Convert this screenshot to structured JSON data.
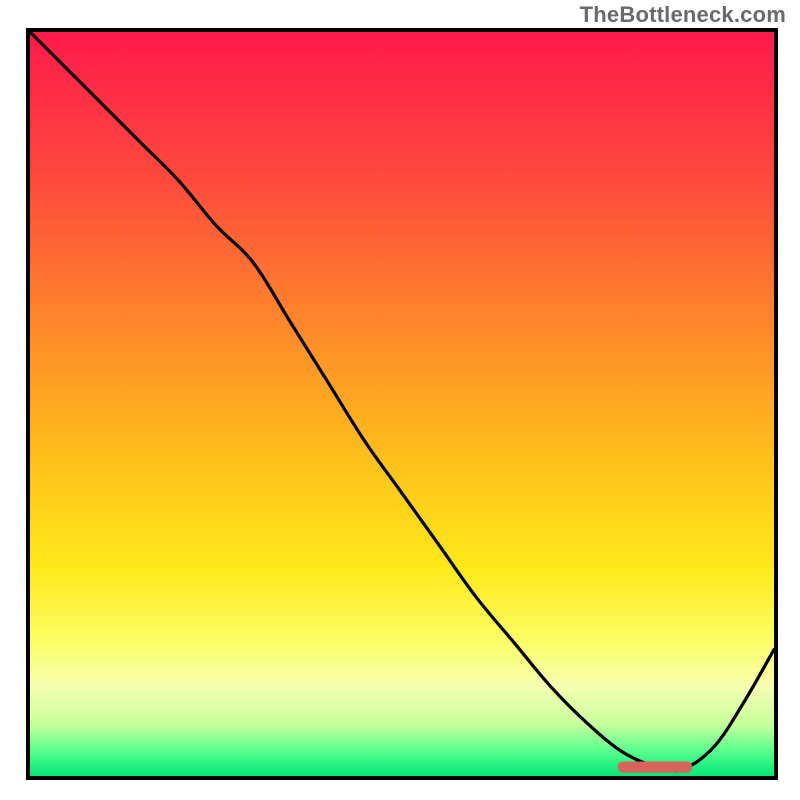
{
  "attribution": "TheBottleneck.com",
  "colors": {
    "border": "#000000",
    "curve": "#000000",
    "marker": "#d9635a",
    "gradient_stops": [
      {
        "offset": 0.0,
        "color": "#ff1a4b"
      },
      {
        "offset": 0.2,
        "color": "#ff4a3d"
      },
      {
        "offset": 0.4,
        "color": "#ff8a2a"
      },
      {
        "offset": 0.58,
        "color": "#ffc21a"
      },
      {
        "offset": 0.72,
        "color": "#ffe91a"
      },
      {
        "offset": 0.82,
        "color": "#fbff66"
      },
      {
        "offset": 0.88,
        "color": "#f6ffb0"
      },
      {
        "offset": 0.93,
        "color": "#c8ff9e"
      },
      {
        "offset": 0.965,
        "color": "#5eff8e"
      },
      {
        "offset": 1.0,
        "color": "#00e676"
      }
    ]
  },
  "chart_data": {
    "type": "line",
    "title": "",
    "xlabel": "",
    "ylabel": "",
    "xlim": [
      0,
      100
    ],
    "ylim": [
      0,
      100
    ],
    "grid": false,
    "series": [
      {
        "name": "bottleneck-curve",
        "x": [
          0,
          5,
          10,
          15,
          20,
          25,
          30,
          35,
          40,
          45,
          50,
          55,
          60,
          65,
          70,
          75,
          80,
          85,
          88,
          92,
          96,
          100
        ],
        "y": [
          100,
          95,
          90,
          85,
          80,
          74,
          69,
          61,
          53,
          45,
          38,
          31,
          24,
          18,
          12,
          7,
          3,
          1,
          1,
          4,
          10,
          17
        ]
      }
    ],
    "annotations": [
      {
        "name": "optimal-marker",
        "shape": "rounded-bar",
        "x_start": 79,
        "x_end": 89,
        "y": 1.2,
        "thickness": 1.5
      }
    ]
  }
}
